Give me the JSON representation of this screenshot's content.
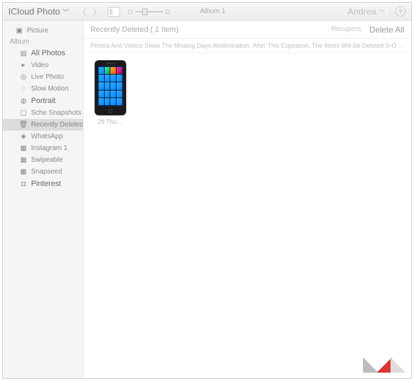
{
  "toolbar": {
    "app_title": "ICloud Photo",
    "breadcrumb": "Album 1",
    "user_name": "Andrea"
  },
  "sidebar": {
    "top_label": "Picture",
    "albums_label": "Album",
    "items": [
      {
        "label": "All Photos",
        "bold": true
      },
      {
        "label": "Video"
      },
      {
        "label": "Live Photo"
      },
      {
        "label": "Slow Motion"
      },
      {
        "label": "Portrait",
        "bold": true
      },
      {
        "label": "Sche Snapshots rmo"
      },
      {
        "label": "Recently Deleted",
        "selected": true
      },
      {
        "label": "WhatsApp"
      },
      {
        "label": "Instagram 1"
      },
      {
        "label": "Swipeable"
      },
      {
        "label": "Snapseed"
      },
      {
        "label": "Pinterest",
        "bold": true
      }
    ]
  },
  "main": {
    "title": "Recently Deleted ( 1 Item)",
    "recover_label": "Recupera",
    "delete_all_label": "Delete All",
    "banner": "Photos And Videos  Show The Missing Days Alrelimination. After This Expiration. The Items Will Be Deleted S-O  …",
    "thumb_label": "28 Thu…"
  }
}
